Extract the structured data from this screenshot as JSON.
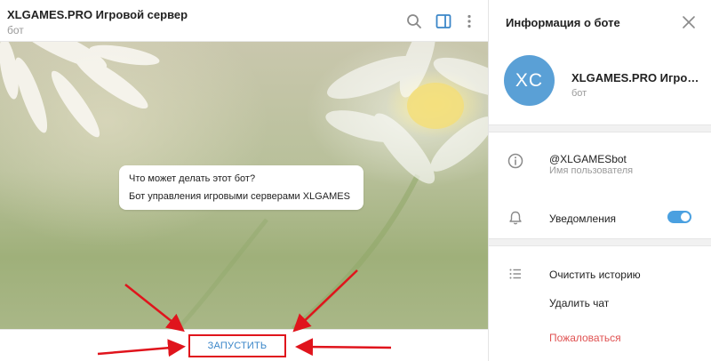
{
  "chat": {
    "title": "XLGAMES.PRO Игровой сервер",
    "status": "бот",
    "info_title": "Что может делать этот бот?",
    "info_text": "Бот управления игровыми серверами XLGAMES",
    "start_label": "ЗАПУСТИТЬ"
  },
  "header_icons": [
    "search-icon",
    "sidebar-toggle-icon",
    "more-vertical-icon"
  ],
  "panel": {
    "title": "Информация о боте",
    "avatar_initials": "XC",
    "name": "XLGAMES.PRO Игровой сервер",
    "status": "бот",
    "username": "@XLGAMESbot",
    "username_label": "Имя пользователя",
    "notifications_label": "Уведомления",
    "notifications_on": true,
    "clear_history": "Очистить историю",
    "delete_chat": "Удалить чат",
    "report": "Пожаловаться"
  },
  "colors": {
    "accent": "#4aa0e0",
    "avatar": "#5aa0d6",
    "annotation_red": "#e0141c",
    "report_red": "#e05252",
    "link_blue": "#3a86c8"
  }
}
